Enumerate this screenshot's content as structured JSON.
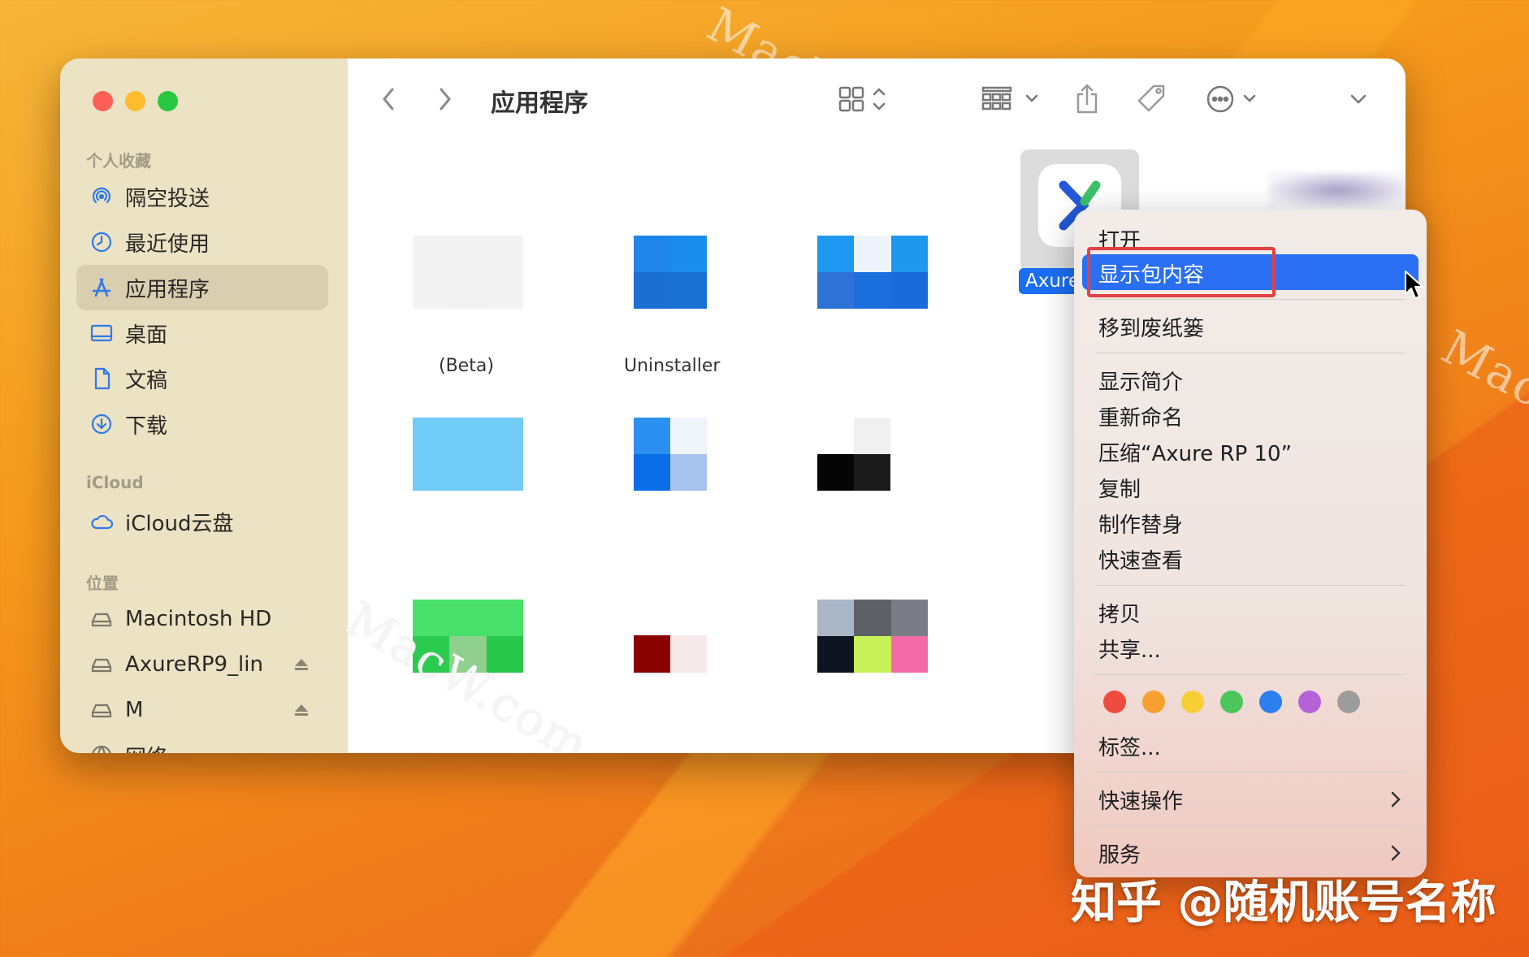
{
  "window": {
    "title": "应用程序"
  },
  "sidebar": {
    "sections": [
      {
        "header": "个人收藏",
        "items": [
          {
            "label": "隔空投送",
            "icon": "airdrop-icon"
          },
          {
            "label": "最近使用",
            "icon": "clock-icon"
          },
          {
            "label": "应用程序",
            "icon": "applications-icon",
            "active": true
          },
          {
            "label": "桌面",
            "icon": "desktop-icon"
          },
          {
            "label": "文稿",
            "icon": "document-icon"
          },
          {
            "label": "下载",
            "icon": "download-icon"
          }
        ]
      },
      {
        "header": "iCloud",
        "items": [
          {
            "label": "iCloud云盘",
            "icon": "cloud-icon"
          }
        ]
      },
      {
        "header": "位置",
        "items": [
          {
            "label": "Macintosh HD",
            "icon": "disk-icon"
          },
          {
            "label": "AxureRP9_lin",
            "icon": "disk-icon",
            "eject": true
          },
          {
            "label": "M",
            "icon": "disk-icon",
            "eject": true
          },
          {
            "label": "网络",
            "icon": "network-icon"
          }
        ]
      }
    ]
  },
  "content": {
    "partial_labels": [
      "(Beta)",
      "Uninstaller"
    ],
    "selected_item_label": "Axure"
  },
  "context_menu": {
    "open": "打开",
    "show_package_contents": "显示包内容",
    "move_to_trash": "移到废纸篓",
    "get_info": "显示简介",
    "rename": "重新命名",
    "compress": "压缩“Axure RP 10”",
    "duplicate": "复制",
    "make_alias": "制作替身",
    "quick_look": "快速查看",
    "copy": "拷贝",
    "share": "共享...",
    "tags_colors": [
      "#ef4b3f",
      "#f5a030",
      "#f7cf35",
      "#4cc65a",
      "#2b7ff0",
      "#b562d8",
      "#9c9c9c"
    ],
    "tags": "标签...",
    "quick_actions": "快速操作",
    "services": "服务"
  },
  "watermarks": [
    "MacW.com",
    "MacW.com",
    "Mac"
  ],
  "footer": {
    "caption": "知乎 @随机账号名称"
  }
}
